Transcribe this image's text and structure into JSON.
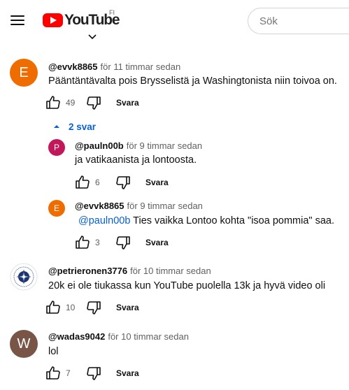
{
  "header": {
    "logo_text": "YouTube",
    "region": "FI",
    "search_placeholder": "Sök"
  },
  "comments": [
    {
      "author": "@evvk8865",
      "time": "för 11 timmar sedan",
      "avatar_letter": "E",
      "avatar_color": "#ef6c00",
      "text": "Pääntäntävalta pois Brysselistä ja Washingtonista niin toivoa on.",
      "likes": "49",
      "reply_label": "Svara",
      "replies_toggle": "2 svar",
      "replies": [
        {
          "author": "@pauln00b",
          "time": "för 9 timmar sedan",
          "avatar_letter": "P",
          "avatar_color": "#c2185b",
          "text": "ja vatikaanista ja lontoosta.",
          "likes": "6",
          "reply_label": "Svara"
        },
        {
          "author": "@evvk8865",
          "time": "för 9 timmar sedan",
          "avatar_letter": "E",
          "avatar_color": "#ef6c00",
          "mention": "@pauln00b",
          "text": " Ties vaikka Lontoo kohta \"isoa pommia\" saa.",
          "likes": "3",
          "reply_label": "Svara"
        }
      ]
    },
    {
      "author": "@petrieronen3776",
      "time": "för 10 timmar sedan",
      "avatar_badge": "nato-emblem-icon",
      "text": "20k ei ole tiukassa kun YouTube puolella 13k ja hyvä video oli",
      "likes": "10",
      "reply_label": "Svara"
    },
    {
      "author": "@wadas9042",
      "time": "för 10 timmar sedan",
      "avatar_letter": "W",
      "avatar_color": "#795548",
      "text": "lol",
      "likes": "7",
      "reply_label": "Svara"
    }
  ]
}
